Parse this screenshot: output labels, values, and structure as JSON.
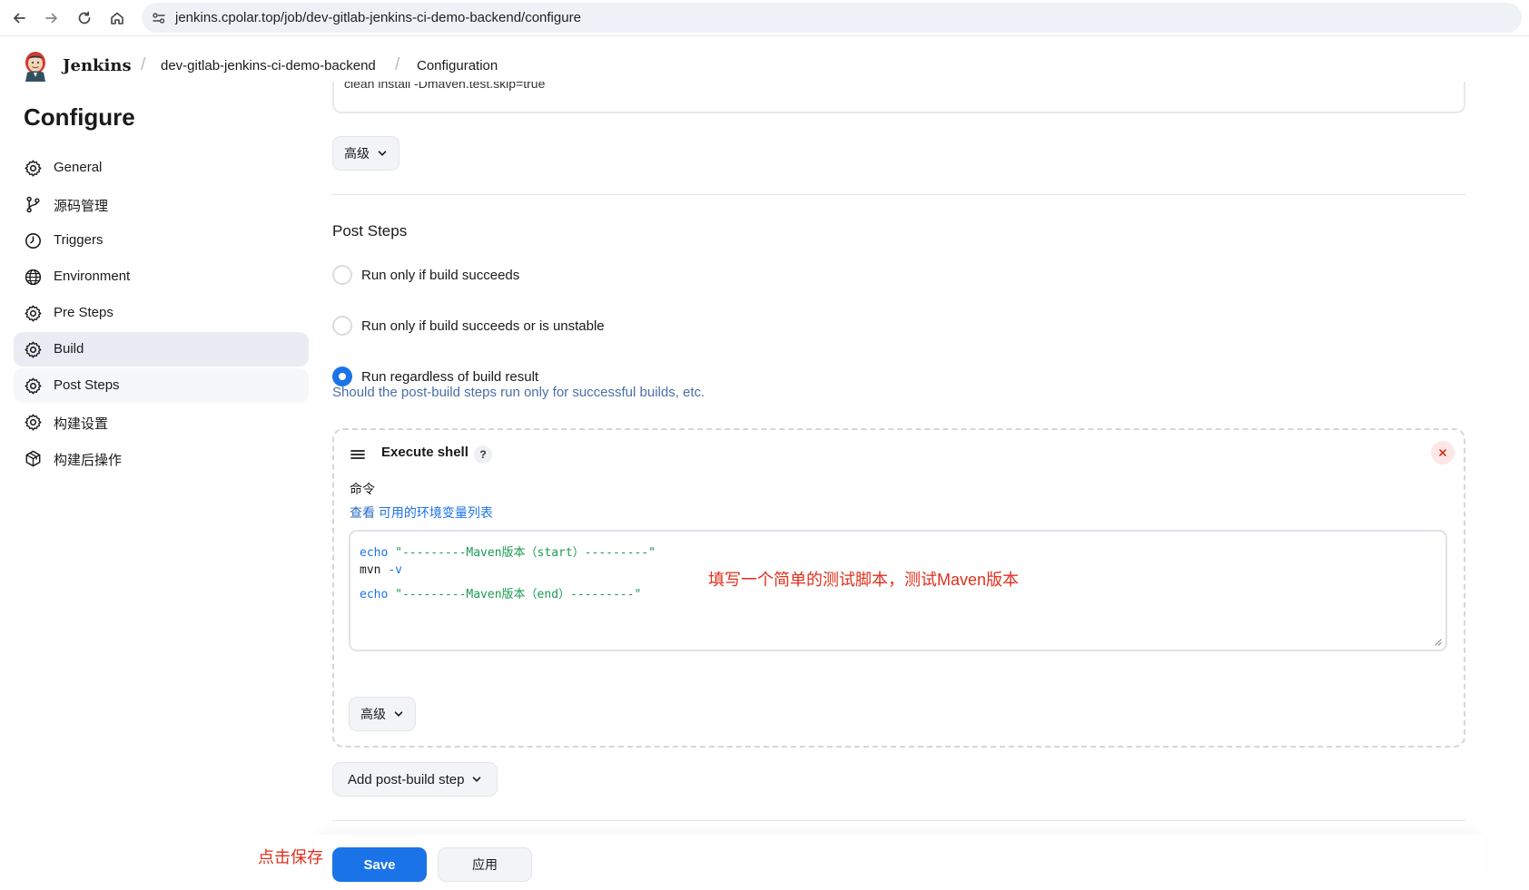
{
  "browser": {
    "url": "jenkins.cpolar.top/job/dev-gitlab-jenkins-ci-demo-backend/configure",
    "buttons": [
      "back-icon",
      "forward-icon",
      "reload-icon",
      "home-icon"
    ]
  },
  "header": {
    "brand": "Jenkins",
    "breadcrumbs": [
      "dev-gitlab-jenkins-ci-demo-backend",
      "Configuration"
    ],
    "separator": "/"
  },
  "sidebar": {
    "title": "Configure",
    "items": [
      {
        "label": "General",
        "icon": "gear-icon"
      },
      {
        "label": "源码管理",
        "icon": "branch-icon"
      },
      {
        "label": "Triggers",
        "icon": "clock-icon"
      },
      {
        "label": "Environment",
        "icon": "globe-icon"
      },
      {
        "label": "Pre Steps",
        "icon": "gear-icon"
      },
      {
        "label": "Build",
        "icon": "gear-icon",
        "state": "active"
      },
      {
        "label": "Post Steps",
        "icon": "gear-icon",
        "state": "hover"
      },
      {
        "label": "构建设置",
        "icon": "gear-icon"
      },
      {
        "label": "构建后操作",
        "icon": "package-icon"
      }
    ]
  },
  "main": {
    "goals_value": "clean install -Dmaven.test.skip=true",
    "advanced_label": "高级",
    "post_steps": {
      "title": "Post Steps",
      "options": [
        {
          "label": "Run only if build succeeds",
          "checked": false
        },
        {
          "label": "Run only if build succeeds or is unstable",
          "checked": false
        },
        {
          "label": "Run regardless of build result",
          "checked": true
        }
      ],
      "help": "Should the post-build steps run only for successful builds, etc."
    },
    "execute_shell": {
      "title": "Execute shell",
      "help_label": "?",
      "command_label": "命令",
      "env_prefix": "查看",
      "env_link": "可用的环境变量列表",
      "code": [
        {
          "kw": "echo",
          "rest": "\"---------Maven版本（start）---------\""
        },
        {
          "kw": "mvn",
          "rest": "-v"
        },
        {
          "kw": "echo",
          "rest": "\"---------Maven版本（end）---------\""
        }
      ],
      "advanced_label": "高级"
    },
    "add_step_label": "Add post-build step",
    "save_label": "Save",
    "apply_label": "应用"
  },
  "annotations": {
    "script_note": "填写一个简单的测试脚本，测试Maven版本",
    "save_note": "点击保存"
  },
  "colors": {
    "accent": "#1b73e8",
    "annotation": "#e0301e",
    "active_item": "#e9edf3"
  }
}
